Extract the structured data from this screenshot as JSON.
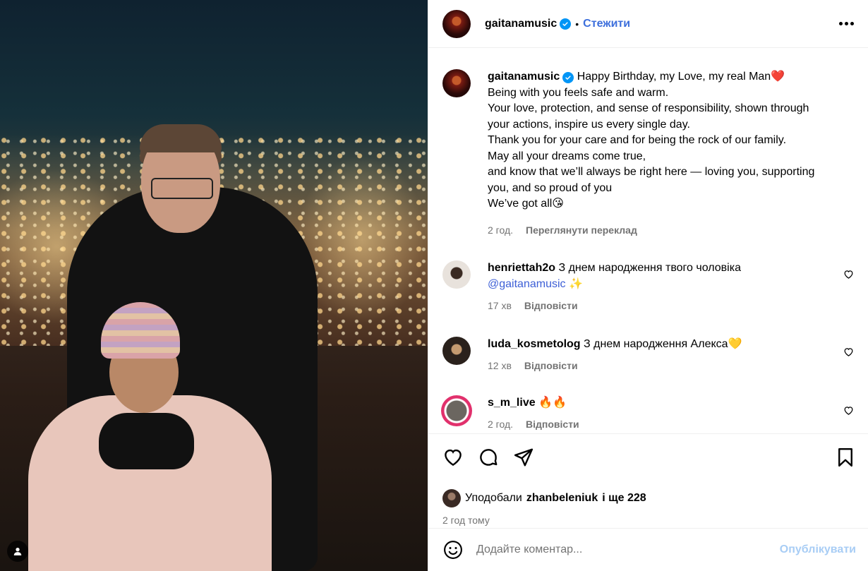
{
  "post": {
    "username": "gaitanamusic",
    "follow_label": "Стежити",
    "separator": "•",
    "caption_lines": [
      "Happy Birthday, my Love, my real Man❤️",
      "Being with you feels safe and warm.",
      "Your love, protection, and sense of responsibility, shown through",
      "your actions, inspire us every single day.",
      "Thank you for your care and for being the rock of our family.",
      "May all your dreams come true,",
      "and know that we’ll always be right here — loving you, supporting",
      "you, and so proud of you",
      "We’ve got all😘"
    ],
    "caption_time": "2 год.",
    "translate_label": "Переглянути переклад"
  },
  "comments": [
    {
      "username": "henriettah2o",
      "text": "З днем народження твого чоловіка",
      "mention": "@gaitanamusic",
      "emoji": "✨",
      "time": "17 хв",
      "reply_label": "Відповісти"
    },
    {
      "username": "luda_kosmetolog",
      "text": "З днем народження Алекса💛",
      "time": "12 хв",
      "reply_label": "Відповісти"
    },
    {
      "username": "s_m_live",
      "text": "🔥🔥",
      "time": "2 год.",
      "reply_label": "Відповісти"
    }
  ],
  "likes": {
    "prefix": "Уподобали",
    "user": "zhanbeleniuk",
    "suffix": "і ще 228"
  },
  "timestamp": "2 год тому",
  "composer": {
    "placeholder": "Додайте коментар...",
    "publish_label": "Опублікувати"
  },
  "icons": {
    "more": "more-options-icon",
    "like": "heart-icon",
    "comment": "comment-icon",
    "share": "share-icon",
    "save": "bookmark-icon",
    "emoji": "emoji-icon",
    "tag": "user-tag-icon",
    "verified": "verified-badge-icon"
  },
  "colors": {
    "link": "#3d6fdc",
    "verified": "#0095f6",
    "muted": "#737373",
    "publish_disabled": "#a8cdf5"
  }
}
